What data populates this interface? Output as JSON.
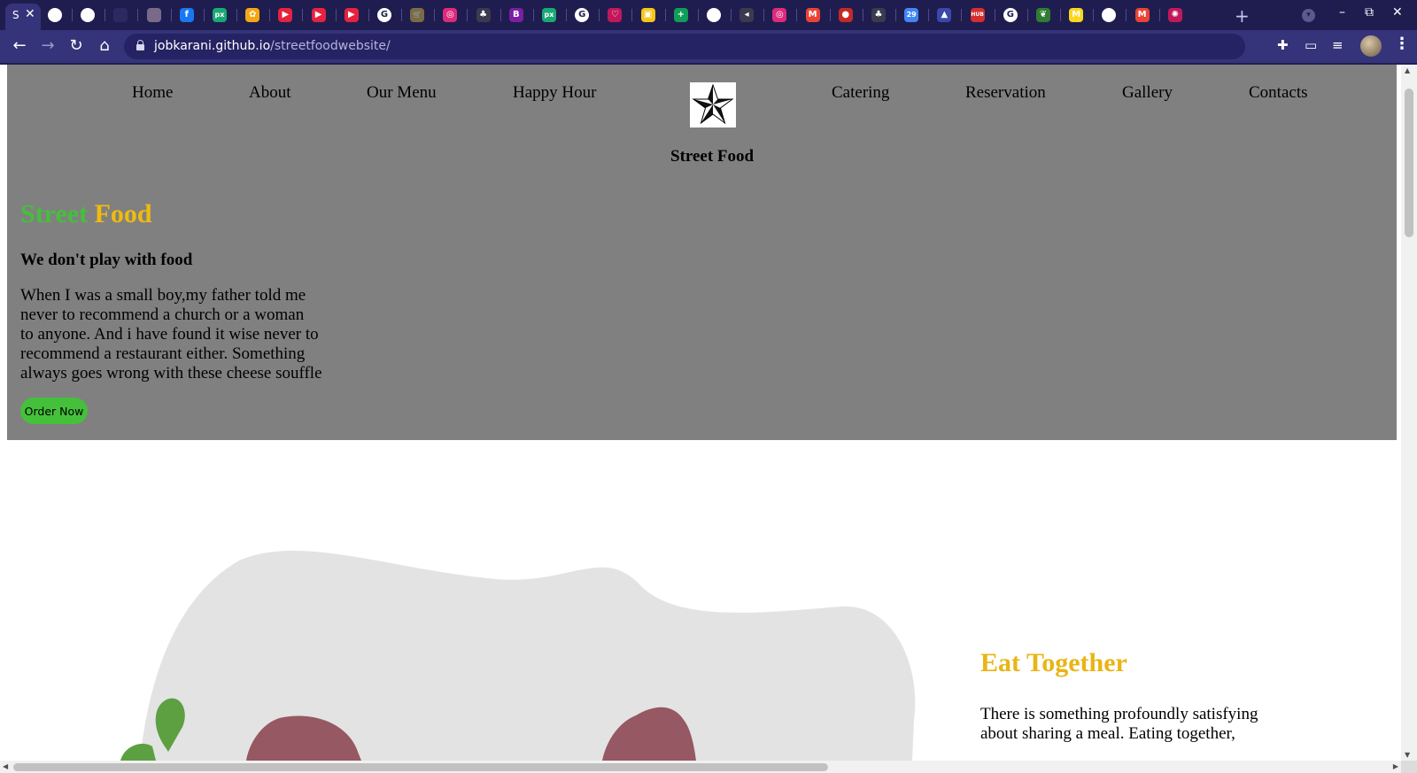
{
  "browser": {
    "active_tab_title": "S",
    "active_tab_close": "✕",
    "tab_icons": [
      {
        "name": "globe-icon",
        "color": "#ffffff",
        "glyph": ""
      },
      {
        "name": "globe-icon",
        "color": "#ffffff",
        "glyph": ""
      },
      {
        "name": "github-icon",
        "color": "#2b2960",
        "glyph": ""
      },
      {
        "name": "photo-icon",
        "color": "#7a6a8a",
        "glyph": ""
      },
      {
        "name": "facebook-icon",
        "color": "#1877f2",
        "glyph": "f"
      },
      {
        "name": "px-icon",
        "color": "#19a974",
        "glyph": "px"
      },
      {
        "name": "flower-icon",
        "color": "#f3a712",
        "glyph": "✿"
      },
      {
        "name": "youtube-music-icon",
        "color": "#e5223f",
        "glyph": "▶"
      },
      {
        "name": "youtube-music-icon",
        "color": "#e5223f",
        "glyph": "▶"
      },
      {
        "name": "youtube-music-icon",
        "color": "#e5223f",
        "glyph": "▶"
      },
      {
        "name": "google-icon",
        "color": "#ffffff",
        "glyph": "G"
      },
      {
        "name": "cart-icon",
        "color": "#7d6a45",
        "glyph": "🛒"
      },
      {
        "name": "instagram-icon",
        "color": "#dd2a7b",
        "glyph": "◎"
      },
      {
        "name": "plant-icon",
        "color": "#3b3b4f",
        "glyph": "♣"
      },
      {
        "name": "b-icon",
        "color": "#7b1fa2",
        "glyph": "B"
      },
      {
        "name": "px-icon",
        "color": "#19a974",
        "glyph": "px"
      },
      {
        "name": "google-icon",
        "color": "#ffffff",
        "glyph": "G"
      },
      {
        "name": "heart-icon",
        "color": "#c2185b",
        "glyph": "♡"
      },
      {
        "name": "keep-icon",
        "color": "#f5c518",
        "glyph": "▣"
      },
      {
        "name": "sheets-icon",
        "color": "#0f9d58",
        "glyph": "+"
      },
      {
        "name": "globe-icon",
        "color": "#ffffff",
        "glyph": ""
      },
      {
        "name": "speaker-icon",
        "color": "#3b3b4f",
        "glyph": "◂"
      },
      {
        "name": "instagram-icon",
        "color": "#dd2a7b",
        "glyph": "◎"
      },
      {
        "name": "gmail-icon",
        "color": "#ea4335",
        "glyph": "M"
      },
      {
        "name": "record-icon",
        "color": "#c62828",
        "glyph": "●"
      },
      {
        "name": "plant-icon",
        "color": "#3b3b4f",
        "glyph": "♣"
      },
      {
        "name": "calendar-icon",
        "color": "#4285f4",
        "glyph": "29"
      },
      {
        "name": "triangle-icon",
        "color": "#3949ab",
        "glyph": "▲"
      },
      {
        "name": "hub-icon",
        "color": "#d32f2f",
        "glyph": "HUB"
      },
      {
        "name": "google-icon",
        "color": "#ffffff",
        "glyph": "G"
      },
      {
        "name": "leaf-icon",
        "color": "#2e7d32",
        "glyph": "❦"
      },
      {
        "name": "m-icon",
        "color": "#f9d71c",
        "glyph": "M"
      },
      {
        "name": "globe-icon",
        "color": "#ffffff",
        "glyph": ""
      },
      {
        "name": "gmail-icon",
        "color": "#ea4335",
        "glyph": "M"
      },
      {
        "name": "settings-icon",
        "color": "#c2185b",
        "glyph": "✺"
      }
    ],
    "url_host": "jobkarani.github.io",
    "url_path": "/streetfoodwebsite/"
  },
  "nav": {
    "left": [
      "Home",
      "About",
      "Our Menu",
      "Happy Hour"
    ],
    "right": [
      "Catering",
      "Reservation",
      "Gallery",
      "Contacts"
    ],
    "brand": "Street Food"
  },
  "hero": {
    "title_part1": "Street",
    "title_part2": "Food",
    "tagline": "We don't play with food",
    "text_lines": [
      "When I was a small boy,my father told me",
      "never to recommend a church or a woman",
      "to anyone. And i have found it wise never to",
      "recommend a restaurant either. Something",
      "always goes wrong with these cheese souffle"
    ],
    "button": "Order Now"
  },
  "eat": {
    "title": "Eat Together",
    "text_lines": [
      "There is something profoundly satisfying",
      "about sharing a meal. Eating together,"
    ]
  },
  "colors": {
    "hero_bg": "#808080",
    "accent_green": "#45c03b",
    "accent_gold": "#f0bb0e",
    "eat_title": "#e9b514",
    "chrome_dark": "#1f1d4f",
    "chrome_toolbar": "#35337a"
  }
}
